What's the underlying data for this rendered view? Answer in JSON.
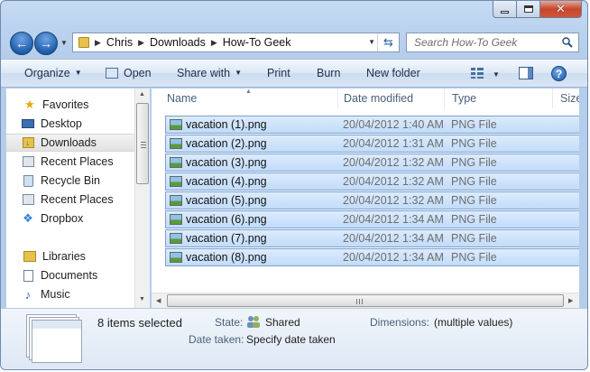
{
  "address_bar": {
    "crumbs": [
      "Chris",
      "Downloads",
      "How-To Geek"
    ]
  },
  "search": {
    "placeholder": "Search How-To Geek"
  },
  "command_bar": {
    "organize": "Organize",
    "open": "Open",
    "share_with": "Share with",
    "print": "Print",
    "burn": "Burn",
    "new_folder": "New folder"
  },
  "nav_pane": {
    "favorites_header": "Favorites",
    "items": [
      "Desktop",
      "Downloads",
      "Recent Places",
      "Recycle Bin",
      "Recent Places",
      "Dropbox"
    ],
    "selected": "Downloads",
    "libraries_header": "Libraries",
    "library_items": [
      "Documents",
      "Music"
    ]
  },
  "file_list": {
    "columns": [
      "Name",
      "Date modified",
      "Type",
      "Size"
    ],
    "files": [
      {
        "name": "vacation (1).png",
        "date": "20/04/2012 1:40 AM",
        "type": "PNG File"
      },
      {
        "name": "vacation (2).png",
        "date": "20/04/2012 1:31 AM",
        "type": "PNG File"
      },
      {
        "name": "vacation (3).png",
        "date": "20/04/2012 1:32 AM",
        "type": "PNG File"
      },
      {
        "name": "vacation (4).png",
        "date": "20/04/2012 1:32 AM",
        "type": "PNG File"
      },
      {
        "name": "vacation (5).png",
        "date": "20/04/2012 1:32 AM",
        "type": "PNG File"
      },
      {
        "name": "vacation (6).png",
        "date": "20/04/2012 1:34 AM",
        "type": "PNG File"
      },
      {
        "name": "vacation (7).png",
        "date": "20/04/2012 1:34 AM",
        "type": "PNG File"
      },
      {
        "name": "vacation (8).png",
        "date": "20/04/2012 1:34 AM",
        "type": "PNG File"
      }
    ]
  },
  "details_pane": {
    "selection": "8 items selected",
    "state_label": "State:",
    "state_value": "Shared",
    "date_taken_label": "Date taken:",
    "date_taken_value": "Specify date taken",
    "dimensions_label": "Dimensions:",
    "dimensions_value": "(multiple values)"
  }
}
